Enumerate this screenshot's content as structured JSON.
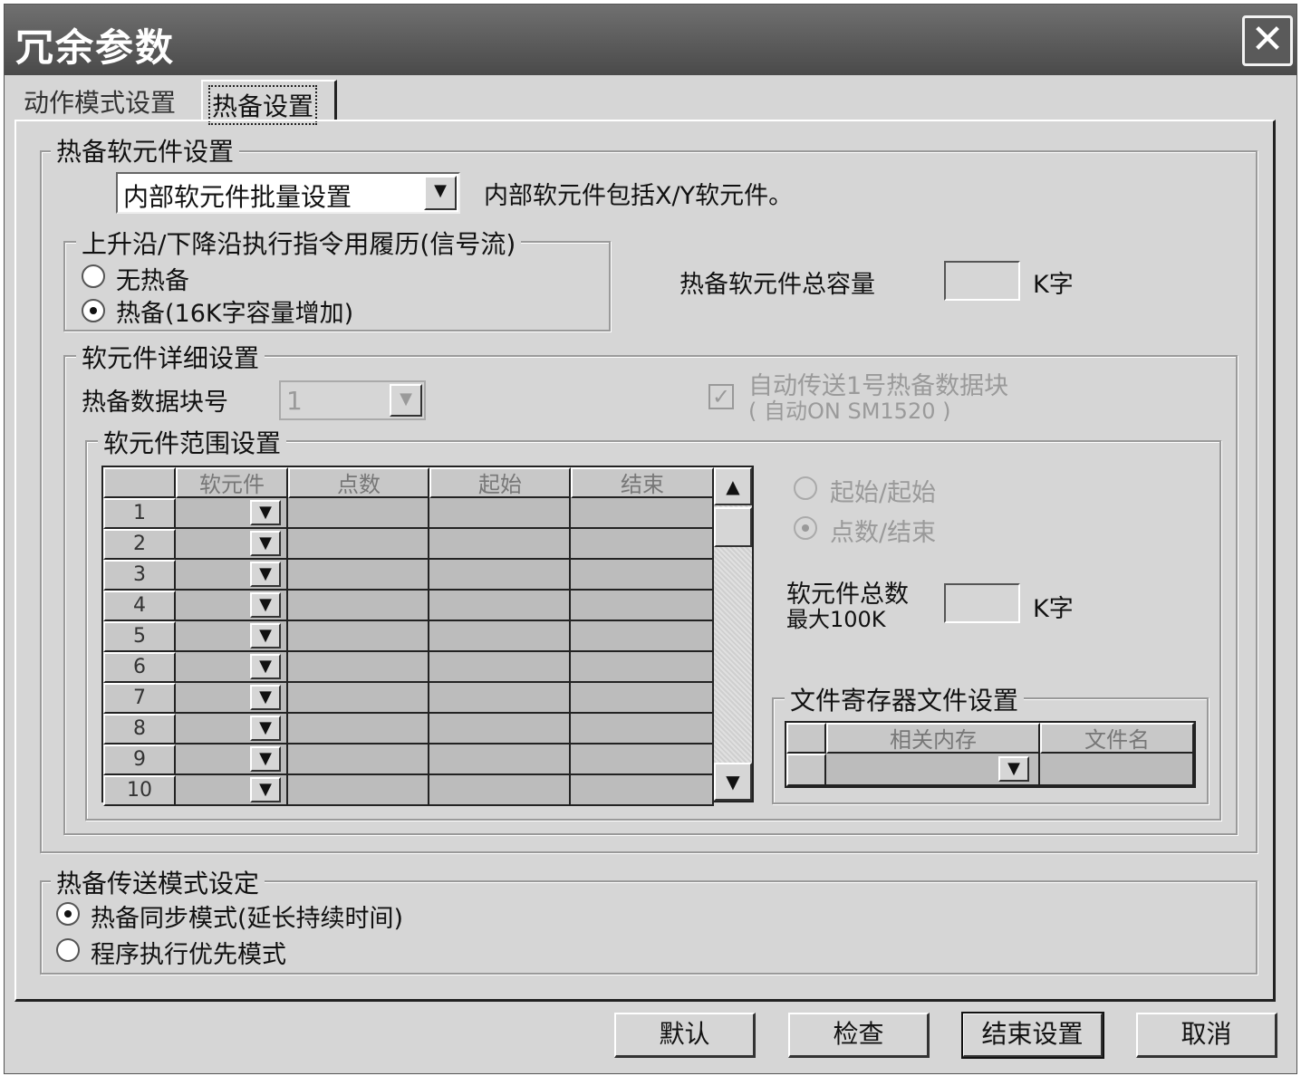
{
  "window": {
    "title": "冗余参数",
    "close_glyph": "✕"
  },
  "tabs": [
    {
      "label": "动作模式设置"
    },
    {
      "label": "热备设置"
    }
  ],
  "hot_device": {
    "group_title": "热备软元件设置",
    "combo_value": "内部软元件批量设置",
    "combo_note": "内部软元件包括X/Y软元件。",
    "edge_group": {
      "title": "上升沿/下降沿执行指令用履历(信号流)",
      "option_none": "无热备",
      "option_hot": "热备(16K字容量增加)",
      "selected": "hot"
    },
    "capacity_label": "热备软元件总容量",
    "capacity_value": "",
    "capacity_unit": "K字"
  },
  "detail": {
    "group_title": "软元件详细设置",
    "block_no_label": "热备数据块号",
    "block_no_value": "1",
    "auto_send_label_1": "自动传送1号热备数据块",
    "auto_send_label_2": "( 自动ON SM1520 )",
    "auto_send_checked": true,
    "range_group_title": "软元件范围设置",
    "columns": [
      "软元件",
      "点数",
      "起始",
      "结束"
    ],
    "rows": [
      "1",
      "2",
      "3",
      "4",
      "5",
      "6",
      "7",
      "8",
      "9",
      "10"
    ],
    "mode_start_start": "起始/起始",
    "mode_points_end": "点数/结束",
    "mode_selected": "points_end",
    "total_label_1": "软元件总数",
    "total_label_2": "最大100K",
    "total_value": "",
    "total_unit": "K字",
    "file_group_title": "文件寄存器文件设置",
    "file_columns": [
      "相关内存",
      "文件名"
    ]
  },
  "transfer": {
    "group_title": "热备传送模式设定",
    "option_sync": "热备同步模式(延长持续时间)",
    "option_priority": "程序执行优先模式",
    "selected": "sync"
  },
  "buttons": {
    "default": "默认",
    "check": "检查",
    "finish": "结束设置",
    "cancel": "取消"
  },
  "icons": {
    "dropdown": "▼",
    "scroll_up": "▲",
    "scroll_down": "▼",
    "check_mark": "✓"
  }
}
